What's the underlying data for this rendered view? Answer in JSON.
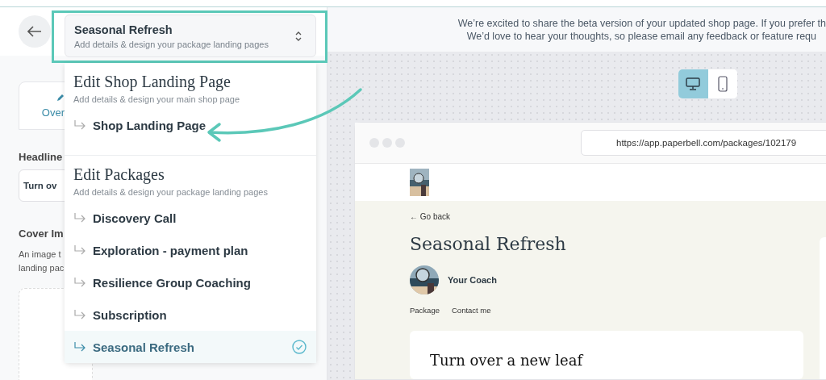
{
  "package_select": {
    "title": "Seasonal Refresh",
    "subtitle": "Add details & design your package landing pages",
    "expanded": true
  },
  "dropdown": {
    "sections": [
      {
        "heading": "Edit Shop Landing Page",
        "subheading": "Add details & design your main shop page",
        "items": [
          {
            "label": "Shop Landing Page",
            "selected": false
          }
        ]
      },
      {
        "heading": "Edit Packages",
        "subheading": "Add details & design your package landing pages",
        "items": [
          {
            "label": "Discovery Call",
            "selected": false
          },
          {
            "label": "Exploration - payment plan",
            "selected": false
          },
          {
            "label": "Resilience Group Coaching",
            "selected": false
          },
          {
            "label": "Subscription",
            "selected": false
          },
          {
            "label": "Seasonal Refresh",
            "selected": true
          }
        ]
      }
    ]
  },
  "editor_panel": {
    "tab": "Over",
    "headline_label": "Headline",
    "headline_value": "Turn ov",
    "cover_label": "Cover Im",
    "cover_help": [
      "An image t",
      "landing pac"
    ]
  },
  "banner": {
    "lines": [
      "We’re excited to share the beta version of your updated shop page. If you prefer th",
      "We’d love to hear your thoughts, so please email any feedback or feature requ"
    ]
  },
  "device_toggle": [
    {
      "kind": "desktop",
      "selected": true
    },
    {
      "kind": "mobile",
      "selected": false
    }
  ],
  "preview": {
    "url": "https://app.paperbell.com/packages/102179",
    "back_link": "← Go back",
    "title": "Seasonal Refresh",
    "coach_name": "Your Coach",
    "nav": [
      "Package",
      "Contact me"
    ],
    "card_heading": "Turn over a new leaf"
  }
}
